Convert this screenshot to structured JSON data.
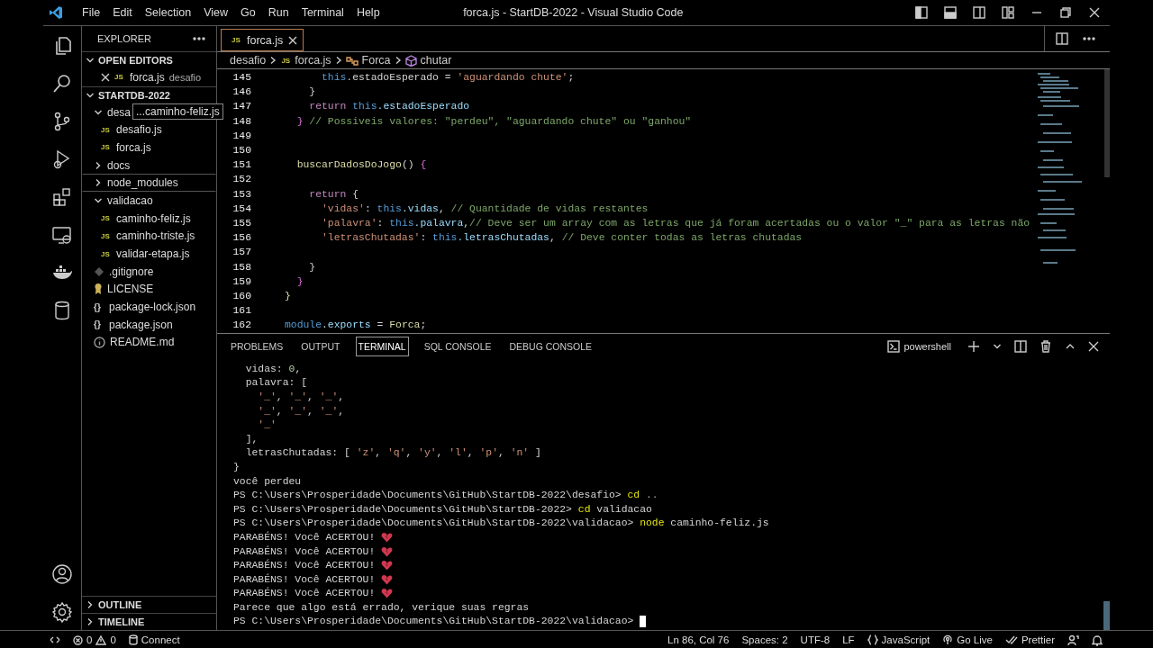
{
  "title_bar": {
    "menu": [
      "File",
      "Edit",
      "Selection",
      "View",
      "Go",
      "Run",
      "Terminal",
      "Help"
    ],
    "title": "forca.js - StartDB-2022 - Visual Studio Code"
  },
  "explorer": {
    "title": "EXPLORER",
    "sections": [
      {
        "label": "OPEN EDITORS",
        "expanded": true,
        "children": [
          {
            "kind": "js",
            "icon": "JS",
            "label": "forca.js",
            "description": "desafio",
            "focused": false
          }
        ]
      },
      {
        "label": "STARTDB-2022",
        "expanded": true,
        "children": [
          {
            "kind": "folder",
            "label": "desa",
            "tooltip": "...caminho-feliz.js",
            "expanded": true,
            "focused": false,
            "children": [
              {
                "kind": "js",
                "icon": "JS",
                "label": "desafio.js",
                "focused": false
              },
              {
                "kind": "js",
                "icon": "JS",
                "label": "forca.js",
                "focused": false
              }
            ]
          },
          {
            "kind": "folder",
            "label": "docs",
            "expanded": false,
            "focused": false
          },
          {
            "kind": "folder",
            "label": "node_modules",
            "expanded": false,
            "focused": true
          },
          {
            "kind": "folder",
            "label": "validacao",
            "expanded": true,
            "focused": false,
            "children": [
              {
                "kind": "js",
                "icon": "JS",
                "label": "caminho-feliz.js",
                "focused": false
              },
              {
                "kind": "js",
                "icon": "JS",
                "label": "caminho-triste.js",
                "focused": false
              },
              {
                "kind": "js",
                "icon": "JS",
                "label": "validar-etapa.js",
                "focused": false
              }
            ]
          },
          {
            "kind": "gitignore",
            "label": ".gitignore",
            "focused": false
          },
          {
            "kind": "license",
            "label": "LICENSE",
            "focused": false
          },
          {
            "kind": "json",
            "icon": "{}",
            "label": "package-lock.json",
            "focused": false
          },
          {
            "kind": "json",
            "icon": "{}",
            "label": "package.json",
            "focused": false
          },
          {
            "kind": "info",
            "label": "README.md",
            "focused": false
          }
        ]
      },
      {
        "label": "OUTLINE",
        "expanded": false
      },
      {
        "label": "TIMELINE",
        "expanded": false
      }
    ]
  },
  "editor": {
    "tabs": [
      {
        "kind": "js",
        "icon": "JS",
        "label": "forca.js",
        "selected": true
      }
    ],
    "breadcrumb": [
      {
        "kind": "folder",
        "label": "desafio"
      },
      {
        "kind": "js",
        "icon": "JS",
        "label": "forca.js"
      },
      {
        "kind": "class",
        "label": "Forca"
      },
      {
        "kind": "method",
        "label": "chutar"
      }
    ],
    "lines": [
      {
        "number": "145",
        "tokens": [
          {
            "kind": "this",
            "text": "      this"
          },
          {
            "kind": "plain",
            "text": ".estadoEsperado = "
          },
          {
            "kind": "string",
            "text": "'aguardando chute'"
          },
          {
            "kind": "plain",
            "text": ";"
          }
        ]
      },
      {
        "number": "146",
        "tokens": [
          {
            "kind": "plain",
            "text": "    }"
          }
        ]
      },
      {
        "number": "147",
        "tokens": [
          {
            "kind": "keyword",
            "text": "    return"
          },
          {
            "kind": "this",
            "text": " this"
          },
          {
            "kind": "prop",
            "text": ".estadoEsperado"
          }
        ]
      },
      {
        "number": "148",
        "tokens": [
          {
            "kind": "bracket",
            "text": "  }"
          },
          {
            "kind": "comment",
            "text": " // Possiveis valores: \"perdeu\", \"aguardando chute\" ou \"ganhou\""
          }
        ]
      },
      {
        "number": "149"
      },
      {
        "number": "150"
      },
      {
        "number": "151",
        "tokens": [
          {
            "kind": "func",
            "text": "  buscarDadosDoJogo"
          },
          {
            "kind": "plain",
            "text": "() "
          },
          {
            "kind": "bracket",
            "text": "{"
          }
        ]
      },
      {
        "number": "152"
      },
      {
        "number": "153",
        "tokens": [
          {
            "kind": "keyword",
            "text": "    return"
          },
          {
            "kind": "plain",
            "text": " {"
          }
        ]
      },
      {
        "number": "154",
        "tokens": [
          {
            "kind": "string",
            "text": "      'vidas'"
          },
          {
            "kind": "plain",
            "text": ": "
          },
          {
            "kind": "this",
            "text": "this"
          },
          {
            "kind": "prop",
            "text": ".vidas"
          },
          {
            "kind": "plain",
            "text": ", "
          },
          {
            "kind": "comment",
            "text": "// Quantidade de vidas restantes"
          }
        ]
      },
      {
        "number": "155",
        "tokens": [
          {
            "kind": "string",
            "text": "      'palavra'"
          },
          {
            "kind": "plain",
            "text": ": "
          },
          {
            "kind": "this",
            "text": "this"
          },
          {
            "kind": "prop",
            "text": ".palavra"
          },
          {
            "kind": "plain",
            "text": ","
          },
          {
            "kind": "comment",
            "text": "// Deve ser um array com as letras que já foram acertadas ou o valor \"_\" para as letras não"
          }
        ]
      },
      {
        "number": "156",
        "tokens": [
          {
            "kind": "string",
            "text": "      'letrasChutadas'"
          },
          {
            "kind": "plain",
            "text": ": "
          },
          {
            "kind": "this",
            "text": "this"
          },
          {
            "kind": "prop",
            "text": ".letrasChutadas"
          },
          {
            "kind": "plain",
            "text": ", "
          },
          {
            "kind": "comment",
            "text": "// Deve conter todas as letras chutadas"
          }
        ]
      },
      {
        "number": "157"
      },
      {
        "number": "158",
        "tokens": [
          {
            "kind": "plain",
            "text": "    }"
          }
        ]
      },
      {
        "number": "159",
        "tokens": [
          {
            "kind": "bracket",
            "text": "  }"
          }
        ]
      },
      {
        "number": "160",
        "tokens": [
          {
            "kind": "func",
            "text": "}"
          }
        ]
      },
      {
        "number": "161"
      },
      {
        "number": "162",
        "tokens": [
          {
            "kind": "this",
            "text": "module"
          },
          {
            "kind": "plain",
            "text": "."
          },
          {
            "kind": "prop",
            "text": "exports"
          },
          {
            "kind": "plain",
            "text": " = "
          },
          {
            "kind": "func",
            "text": "Forca"
          },
          {
            "kind": "plain",
            "text": ";"
          }
        ]
      }
    ]
  },
  "panel": {
    "tabs": [
      {
        "label": "PROBLEMS",
        "selected": false
      },
      {
        "label": "OUTPUT",
        "selected": false
      },
      {
        "label": "TERMINAL",
        "selected": true
      },
      {
        "label": "SQL CONSOLE",
        "selected": false
      },
      {
        "label": "DEBUG CONSOLE",
        "selected": false
      }
    ],
    "shell": "powershell",
    "lines": [
      [
        {
          "kind": "plain",
          "text": "  vidas: "
        },
        {
          "kind": "number",
          "text": "0"
        },
        {
          "kind": "plain",
          "text": ","
        }
      ],
      [
        {
          "kind": "plain",
          "text": "  palavra: ["
        }
      ],
      [
        {
          "kind": "string",
          "text": "    '_'"
        },
        {
          "kind": "plain",
          "text": ", "
        },
        {
          "kind": "string",
          "text": "'_'"
        },
        {
          "kind": "plain",
          "text": ", "
        },
        {
          "kind": "string",
          "text": "'_'"
        },
        {
          "kind": "plain",
          "text": ","
        }
      ],
      [
        {
          "kind": "string",
          "text": "    '_'"
        },
        {
          "kind": "plain",
          "text": ", "
        },
        {
          "kind": "string",
          "text": "'_'"
        },
        {
          "kind": "plain",
          "text": ", "
        },
        {
          "kind": "string",
          "text": "'_'"
        },
        {
          "kind": "plain",
          "text": ","
        }
      ],
      [
        {
          "kind": "string",
          "text": "    '_'"
        }
      ],
      [
        {
          "kind": "plain",
          "text": "  ],"
        }
      ],
      [
        {
          "kind": "plain",
          "text": "  letrasChutadas: [ "
        },
        {
          "kind": "string",
          "text": "'z'"
        },
        {
          "kind": "plain",
          "text": ", "
        },
        {
          "kind": "string",
          "text": "'q'"
        },
        {
          "kind": "plain",
          "text": ", "
        },
        {
          "kind": "string",
          "text": "'y'"
        },
        {
          "kind": "plain",
          "text": ", "
        },
        {
          "kind": "string",
          "text": "'l'"
        },
        {
          "kind": "plain",
          "text": ", "
        },
        {
          "kind": "string",
          "text": "'p'"
        },
        {
          "kind": "plain",
          "text": ", "
        },
        {
          "kind": "string",
          "text": "'n'"
        },
        {
          "kind": "plain",
          "text": " ]"
        }
      ],
      [
        {
          "kind": "plain",
          "text": "}"
        }
      ],
      [
        {
          "kind": "plain",
          "text": "você perdeu"
        }
      ],
      [
        {
          "kind": "plain",
          "text": "PS C:\\Users\\Prosperidade\\Documents\\GitHub\\StartDB-2022\\desafio> "
        },
        {
          "kind": "command",
          "text": "cd"
        },
        {
          "kind": "arg",
          "text": " .."
        }
      ],
      [
        {
          "kind": "plain",
          "text": "PS C:\\Users\\Prosperidade\\Documents\\GitHub\\StartDB-2022> "
        },
        {
          "kind": "command",
          "text": "cd"
        },
        {
          "kind": "plain",
          "text": " validacao"
        }
      ],
      [
        {
          "kind": "plain",
          "text": "PS C:\\Users\\Prosperidade\\Documents\\GitHub\\StartDB-2022\\validacao> "
        },
        {
          "kind": "command",
          "text": "node"
        },
        {
          "kind": "plain",
          "text": " caminho-feliz.js"
        }
      ],
      [
        {
          "kind": "plain",
          "text": "PARABÉNS! Você ACERTOU! "
        },
        {
          "kind": "heart"
        }
      ],
      [
        {
          "kind": "plain",
          "text": "PARABÉNS! Você ACERTOU! "
        },
        {
          "kind": "heart"
        }
      ],
      [
        {
          "kind": "plain",
          "text": "PARABÉNS! Você ACERTOU! "
        },
        {
          "kind": "heart"
        }
      ],
      [
        {
          "kind": "plain",
          "text": "PARABÉNS! Você ACERTOU! "
        },
        {
          "kind": "heart"
        }
      ],
      [
        {
          "kind": "plain",
          "text": "PARABÉNS! Você ACERTOU! "
        },
        {
          "kind": "heart"
        }
      ],
      [
        {
          "kind": "plain",
          "text": "Parece que algo está errado, verique suas regras"
        }
      ],
      [
        {
          "kind": "plain",
          "text": "PS C:\\Users\\Prosperidade\\Documents\\GitHub\\StartDB-2022\\validacao> "
        },
        {
          "kind": "cursor"
        }
      ]
    ]
  },
  "status_bar": {
    "errors": "0",
    "warnings": "0",
    "connect": "Connect",
    "items": [
      {
        "kind": "text",
        "text": "Ln 86, Col 76"
      },
      {
        "kind": "text",
        "text": "Spaces: 2"
      },
      {
        "kind": "text",
        "text": "UTF-8"
      },
      {
        "kind": "text",
        "text": "LF"
      },
      {
        "kind": "language",
        "text": "JavaScript"
      },
      {
        "kind": "golive",
        "text": "Go Live"
      },
      {
        "kind": "prettier",
        "text": "Prettier"
      },
      {
        "kind": "feedback"
      },
      {
        "kind": "bell"
      }
    ]
  }
}
